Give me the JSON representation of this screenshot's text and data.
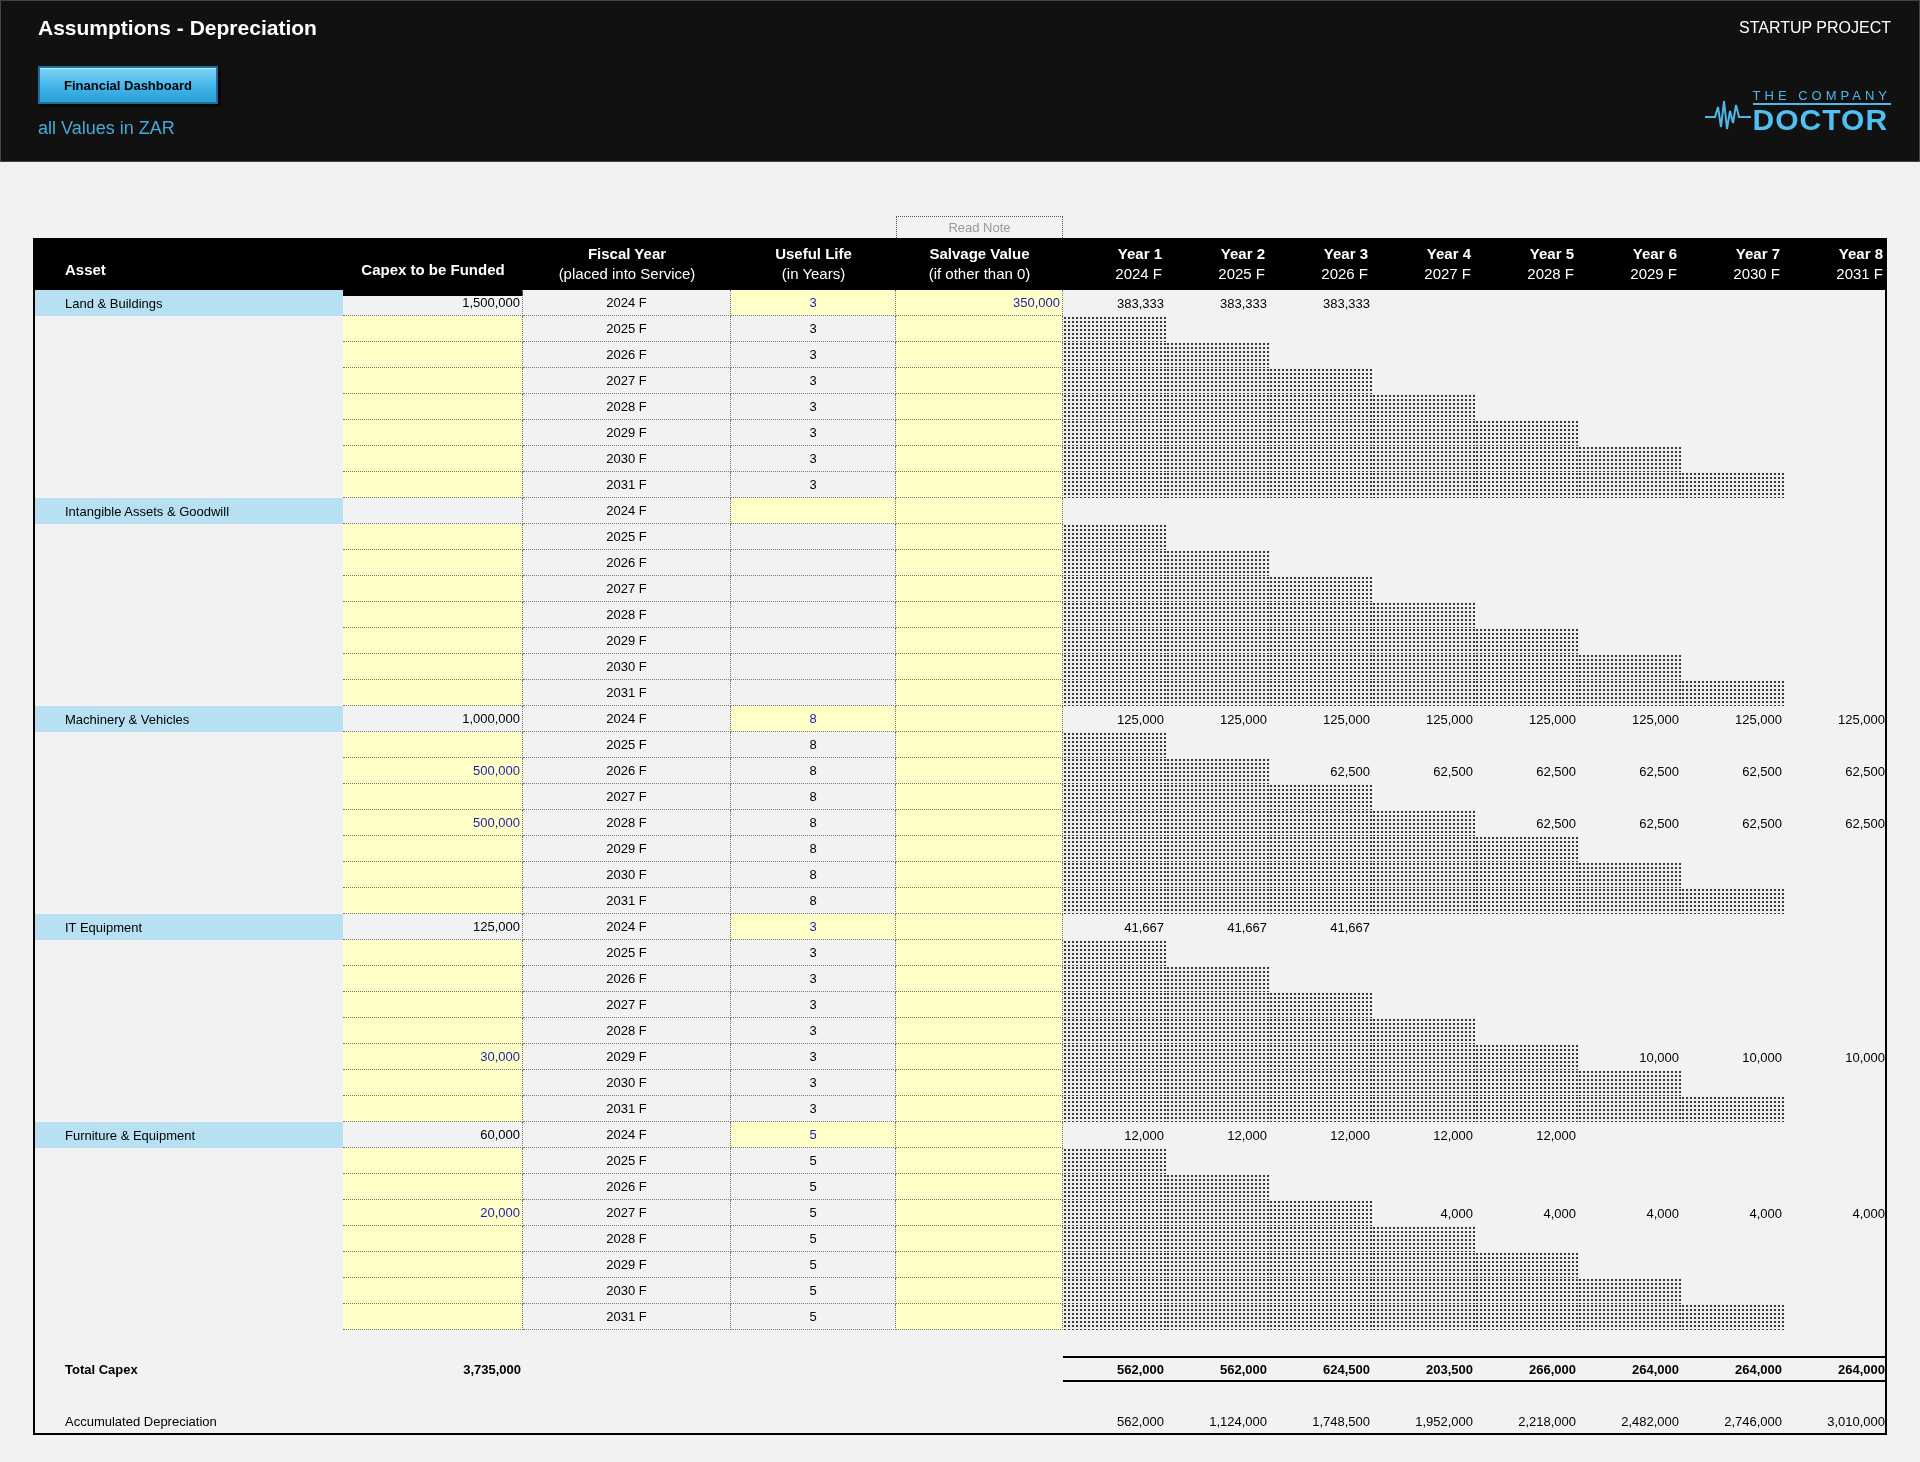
{
  "header": {
    "title": "Assumptions - Depreciation",
    "project": "STARTUP PROJECT",
    "button": "Financial Dashboard",
    "currency_note": "all Values in ZAR",
    "logo": {
      "top": "THE COMPANY",
      "main": "DOCTOR"
    }
  },
  "note_button": "Read Note",
  "columns": [
    {
      "title": "Asset"
    },
    {
      "title": "Capex to be Funded"
    },
    {
      "title": "Fiscal Year",
      "subtitle": "(placed into Service)"
    },
    {
      "title": "Useful Life",
      "subtitle": "(in Years)"
    },
    {
      "title": "Salvage Value",
      "subtitle": "(if other than 0)"
    }
  ],
  "year_columns": [
    {
      "title": "Year 1",
      "subtitle": "2024 F"
    },
    {
      "title": "Year 2",
      "subtitle": "2025 F"
    },
    {
      "title": "Year 3",
      "subtitle": "2026 F"
    },
    {
      "title": "Year 4",
      "subtitle": "2027 F"
    },
    {
      "title": "Year 5",
      "subtitle": "2028 F"
    },
    {
      "title": "Year 6",
      "subtitle": "2029 F"
    },
    {
      "title": "Year 7",
      "subtitle": "2030 F"
    },
    {
      "title": "Year 8",
      "subtitle": "2031 F"
    }
  ],
  "groups": [
    {
      "asset": "Land & Buildings",
      "rows": [
        {
          "capex": "1,500,000",
          "fiscal_year": "2024 F",
          "useful_life": "3",
          "salvage": "350,000",
          "depreciation": [
            "383,333",
            "383,333",
            "383,333"
          ]
        },
        {
          "fiscal_year": "2025 F",
          "useful_life": "3"
        },
        {
          "fiscal_year": "2026 F",
          "useful_life": "3"
        },
        {
          "fiscal_year": "2027 F",
          "useful_life": "3"
        },
        {
          "fiscal_year": "2028 F",
          "useful_life": "3"
        },
        {
          "fiscal_year": "2029 F",
          "useful_life": "3"
        },
        {
          "fiscal_year": "2030 F",
          "useful_life": "3"
        },
        {
          "fiscal_year": "2031 F",
          "useful_life": "3"
        }
      ]
    },
    {
      "asset": "Intangible Assets & Goodwill",
      "rows": [
        {
          "fiscal_year": "2024 F"
        },
        {
          "fiscal_year": "2025 F"
        },
        {
          "fiscal_year": "2026 F"
        },
        {
          "fiscal_year": "2027 F"
        },
        {
          "fiscal_year": "2028 F"
        },
        {
          "fiscal_year": "2029 F"
        },
        {
          "fiscal_year": "2030 F"
        },
        {
          "fiscal_year": "2031 F"
        }
      ]
    },
    {
      "asset": "Machinery & Vehicles",
      "rows": [
        {
          "capex": "1,000,000",
          "fiscal_year": "2024 F",
          "useful_life": "8",
          "depreciation": [
            "125,000",
            "125,000",
            "125,000",
            "125,000",
            "125,000",
            "125,000",
            "125,000",
            "125,000"
          ]
        },
        {
          "fiscal_year": "2025 F",
          "useful_life": "8"
        },
        {
          "capex": "500,000",
          "fiscal_year": "2026 F",
          "useful_life": "8",
          "depreciation": [
            "62,500",
            "62,500",
            "62,500",
            "62,500",
            "62,500",
            "62,500"
          ]
        },
        {
          "fiscal_year": "2027 F",
          "useful_life": "8"
        },
        {
          "capex": "500,000",
          "fiscal_year": "2028 F",
          "useful_life": "8",
          "depreciation": [
            "62,500",
            "62,500",
            "62,500",
            "62,500"
          ]
        },
        {
          "fiscal_year": "2029 F",
          "useful_life": "8"
        },
        {
          "fiscal_year": "2030 F",
          "useful_life": "8"
        },
        {
          "fiscal_year": "2031 F",
          "useful_life": "8"
        }
      ]
    },
    {
      "asset": "IT Equipment",
      "rows": [
        {
          "capex": "125,000",
          "fiscal_year": "2024 F",
          "useful_life": "3",
          "depreciation": [
            "41,667",
            "41,667",
            "41,667"
          ]
        },
        {
          "fiscal_year": "2025 F",
          "useful_life": "3"
        },
        {
          "fiscal_year": "2026 F",
          "useful_life": "3"
        },
        {
          "fiscal_year": "2027 F",
          "useful_life": "3"
        },
        {
          "fiscal_year": "2028 F",
          "useful_life": "3"
        },
        {
          "capex": "30,000",
          "fiscal_year": "2029 F",
          "useful_life": "3",
          "depreciation": [
            "10,000",
            "10,000",
            "10,000"
          ]
        },
        {
          "fiscal_year": "2030 F",
          "useful_life": "3"
        },
        {
          "fiscal_year": "2031 F",
          "useful_life": "3"
        }
      ]
    },
    {
      "asset": "Furniture & Equipment",
      "rows": [
        {
          "capex": "60,000",
          "fiscal_year": "2024 F",
          "useful_life": "5",
          "depreciation": [
            "12,000",
            "12,000",
            "12,000",
            "12,000",
            "12,000"
          ]
        },
        {
          "fiscal_year": "2025 F",
          "useful_life": "5"
        },
        {
          "fiscal_year": "2026 F",
          "useful_life": "5"
        },
        {
          "capex": "20,000",
          "fiscal_year": "2027 F",
          "useful_life": "5",
          "depreciation": [
            "4,000",
            "4,000",
            "4,000",
            "4,000",
            "4,000"
          ]
        },
        {
          "fiscal_year": "2028 F",
          "useful_life": "5"
        },
        {
          "fiscal_year": "2029 F",
          "useful_life": "5"
        },
        {
          "fiscal_year": "2030 F",
          "useful_life": "5"
        },
        {
          "fiscal_year": "2031 F",
          "useful_life": "5"
        }
      ]
    }
  ],
  "total": {
    "label": "Total Capex",
    "capex": "3,735,000",
    "values": [
      "562,000",
      "562,000",
      "624,500",
      "203,500",
      "266,000",
      "264,000",
      "264,000",
      "264,000"
    ]
  },
  "accumulated": {
    "label": "Accumulated Depreciation",
    "values": [
      "562,000",
      "1,124,000",
      "1,748,500",
      "1,952,000",
      "2,218,000",
      "2,482,000",
      "2,746,000",
      "3,010,000"
    ]
  }
}
